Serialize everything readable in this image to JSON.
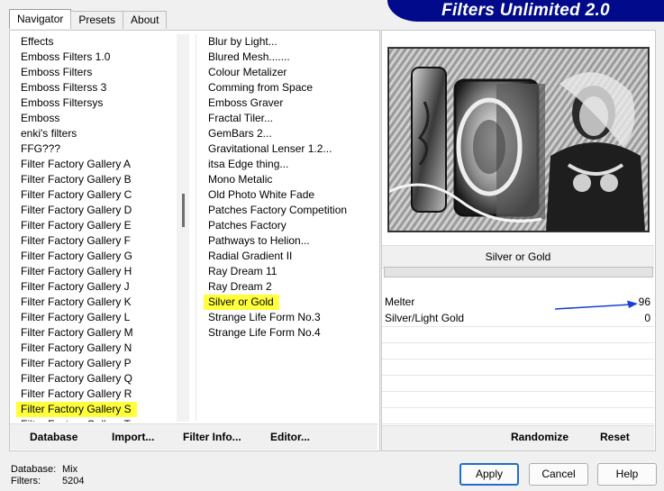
{
  "title": "Filters Unlimited 2.0",
  "tabs": [
    {
      "label": "Navigator",
      "active": true
    },
    {
      "label": "Presets",
      "active": false
    },
    {
      "label": "About",
      "active": false
    }
  ],
  "categories": [
    "Effects",
    "Emboss Filters 1.0",
    "Emboss Filters",
    "Emboss Filterss 3",
    "Emboss Filtersys",
    "Emboss",
    "enki's filters",
    "FFG???",
    "Filter Factory Gallery A",
    "Filter Factory Gallery B",
    "Filter Factory Gallery C",
    "Filter Factory Gallery D",
    "Filter Factory Gallery E",
    "Filter Factory Gallery F",
    "Filter Factory Gallery G",
    "Filter Factory Gallery H",
    "Filter Factory Gallery J",
    "Filter Factory Gallery K",
    "Filter Factory Gallery L",
    "Filter Factory Gallery M",
    "Filter Factory Gallery N",
    "Filter Factory Gallery P",
    "Filter Factory Gallery Q",
    "Filter Factory Gallery R",
    "Filter Factory Gallery S",
    "Filter Factory Gallery T"
  ],
  "selected_category": "Filter Factory Gallery S",
  "filters": [
    "Blur by Light...",
    "Blured Mesh.......",
    "Colour Metalizer",
    "Comming from Space",
    "Emboss Graver",
    "Fractal Tiler...",
    "GemBars 2...",
    "Gravitational Lenser 1.2...",
    "itsa Edge thing...",
    "Mono Metalic",
    "Old Photo White Fade",
    "Patches Factory Competition",
    "Patches Factory",
    "Pathways to Helion...",
    "Radial Gradient II",
    "Ray Dream 11",
    "Ray Dream 2",
    "Silver or Gold",
    "Strange Life Form No.3",
    "Strange Life Form No.4"
  ],
  "selected_filter": "Silver or Gold",
  "left_buttons": {
    "database": "Database",
    "import": "Import...",
    "filter_info": "Filter Info...",
    "editor": "Editor..."
  },
  "filter_name": "Silver or Gold",
  "parameters": [
    {
      "label": "Melter",
      "value": "96"
    },
    {
      "label": "Silver/Light Gold",
      "value": "0"
    }
  ],
  "right_buttons": {
    "randomize": "Randomize",
    "reset": "Reset"
  },
  "status": {
    "database_label": "Database:",
    "database_value": "Mix",
    "filters_label": "Filters:",
    "filters_value": "5204"
  },
  "dialog_buttons": {
    "apply": "Apply",
    "cancel": "Cancel",
    "help": "Help"
  },
  "colors": {
    "banner": "#000a8a",
    "highlight": "#ffff3c",
    "arrow": "#1a3fd6",
    "default_button_border": "#1f6fc8"
  }
}
